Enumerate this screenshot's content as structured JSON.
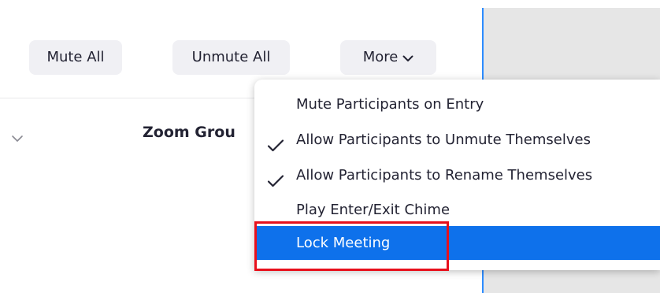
{
  "toolbar": {
    "mute_all_label": "Mute All",
    "unmute_all_label": "Unmute All",
    "more_label": "More"
  },
  "participants": {
    "group_name": "Zoom Grou"
  },
  "more_menu": {
    "items": [
      {
        "label": "Mute Participants on Entry",
        "checked": false
      },
      {
        "label": "Allow Participants to Unmute Themselves",
        "checked": true
      },
      {
        "label": "Allow Participants to Rename Themselves",
        "checked": true
      },
      {
        "label": "Play Enter/Exit Chime",
        "checked": false
      },
      {
        "label": "Lock Meeting",
        "checked": false,
        "highlighted": true
      }
    ]
  },
  "colors": {
    "accent_blue": "#0e71eb",
    "button_bg": "#f0f0f4",
    "text": "#232333",
    "annotation_red": "#e8101c",
    "pane_border": "#2d8cff"
  },
  "icons": {
    "more_chevron": "chevron-down-icon",
    "group_collapse": "chevron-down-icon",
    "checkmark": "check-icon"
  }
}
